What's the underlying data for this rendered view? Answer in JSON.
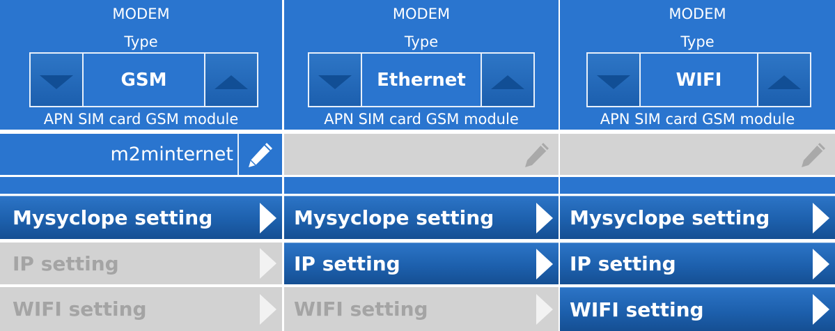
{
  "screens": [
    {
      "modem_line1": "MODEM",
      "modem_line2": "Type",
      "modem_type": "GSM",
      "apn_caption": "APN SIM card GSM module",
      "apn_value": "m2minternet",
      "apn_enabled": true,
      "menu": [
        {
          "label": "Mysyclope setting",
          "enabled": true
        },
        {
          "label": "IP setting",
          "enabled": false
        },
        {
          "label": "WIFI setting",
          "enabled": false
        }
      ]
    },
    {
      "modem_line1": "MODEM",
      "modem_line2": "Type",
      "modem_type": "Ethernet",
      "apn_caption": "APN SIM card GSM module",
      "apn_value": "",
      "apn_enabled": false,
      "menu": [
        {
          "label": "Mysyclope setting",
          "enabled": true
        },
        {
          "label": "IP setting",
          "enabled": true
        },
        {
          "label": "WIFI setting",
          "enabled": false
        }
      ]
    },
    {
      "modem_line1": "MODEM",
      "modem_line2": "Type",
      "modem_type": "WIFI",
      "apn_caption": "APN SIM card GSM module",
      "apn_value": "",
      "apn_enabled": false,
      "menu": [
        {
          "label": "Mysyclope setting",
          "enabled": true
        },
        {
          "label": "IP setting",
          "enabled": true
        },
        {
          "label": "WIFI setting",
          "enabled": true
        }
      ]
    }
  ],
  "icons": {
    "decrease": "triangle-down-icon",
    "increase": "triangle-up-icon",
    "edit": "pencil-icon",
    "open": "chevron-right-icon"
  },
  "colors": {
    "panel_blue": "#2a75cf",
    "menu_blue_top": "#2c74c6",
    "menu_blue_bottom": "#154f93",
    "disabled_gray": "#d2d2d2",
    "disabled_text": "#a4a4a4",
    "arrow_dark": "#114e95"
  }
}
